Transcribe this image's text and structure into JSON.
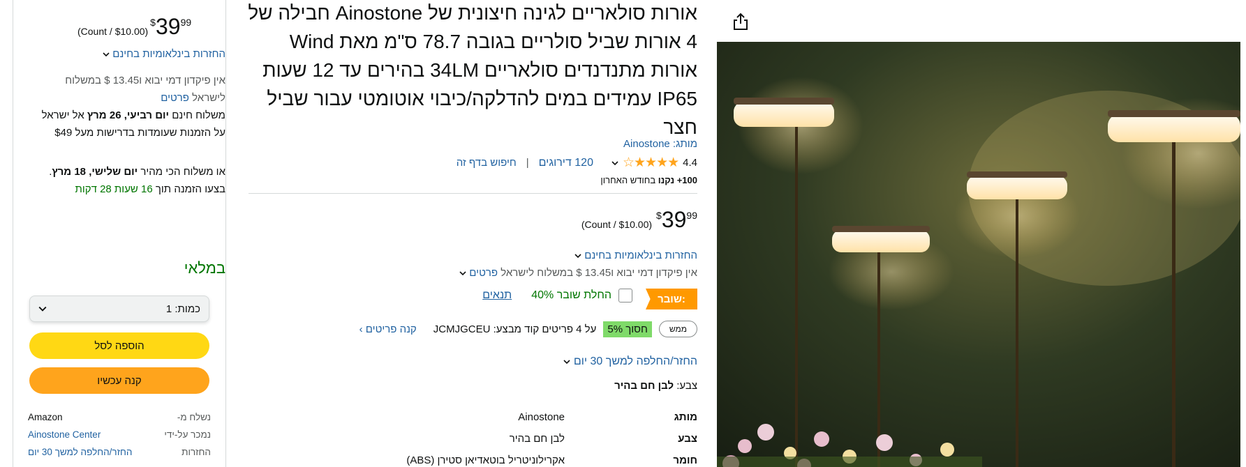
{
  "buybox": {
    "price": {
      "currency": "$",
      "whole": "39",
      "fraction": "99",
      "unit": "(Count / $10.00)"
    },
    "free_returns": "החזרות בינלאומיות בחינם",
    "import_fees_line1": "אין פיקדון דמי יבוא ו13.45 $ במשלוח",
    "import_fees_line2": "לישראל",
    "details_link": "פרטים",
    "delivery_prefix": "משלוח חינם ",
    "delivery_date": "יום רביעי, 26 מרץ",
    "delivery_suffix": " אל ישראל על הזמנות שעומדות בדרישות מעל $49",
    "fastest_prefix": "או משלוח הכי מהיר ",
    "fastest_date": "יום שלישי, 18 מרץ",
    "fastest_middle": ". בצעו הזמנה תוך ",
    "fastest_countdown": "16 שעות 28 דקות",
    "in_stock": "במלאי",
    "quantity_label": "כמות:",
    "quantity_value": "1",
    "add_to_cart": "הוספה לסל",
    "buy_now": "קנה עכשיו",
    "info": [
      {
        "key": "נשלח מ-",
        "value": "Amazon",
        "link": false
      },
      {
        "key": "נמכר על-ידי",
        "value": "Ainostone Center",
        "link": true
      },
      {
        "key": "החזרות",
        "value": "החזר/החלפה למשך 30 יום",
        "link": true
      }
    ]
  },
  "product": {
    "title": "אורות סולאריים לגינה חיצונית של Ainostone חבילה של 4 אורות שביל סולריים בגובה 78.7 ס\"מ מאת Wind אורות מתנדנדים סולאריים 34LM בהירים עד 12 שעות IP65 עמידים במים להדלקה/כיבוי אוטומטי עבור שביל חצר",
    "brand_line": "מותג: Ainostone",
    "rating": "4.4",
    "stars": "★★★★☆",
    "ratings_count": "120 דירוגים",
    "separator": "|",
    "search_page": "חיפוש בדף זה",
    "bought_bold": "100+ נקנו",
    "bought_rest": " בחודש האחרון",
    "price": {
      "currency": "$",
      "whole": "39",
      "fraction": "99",
      "unit": "(Count / $10.00)"
    },
    "free_returns": "החזרות בינלאומיות בחינם",
    "import_fees": "אין פיקדון דמי יבוא ו13.45 $ במשלוח לישראל",
    "details_link": "פרטים",
    "deal_badge": "שובר:",
    "coupon_text": "החלת שובר 40%",
    "coupon_terms": "תנאים",
    "promo_button": "ממש",
    "promo_save": "חסוך 5%",
    "promo_text": "על 4 פריטים קוד מבצע: JCMJGCEU",
    "promo_link": "קנה פריטים ›",
    "returns_policy": "החזר/החלפה למשך 30 יום",
    "color_label": "צבע: ",
    "color_value": "לבן חם בהיר",
    "specs": [
      {
        "key": "מותג",
        "value": "Ainostone"
      },
      {
        "key": "צבע",
        "value": "לבן חם בהיר"
      },
      {
        "key": "חומר",
        "value": "אקרילוניטריל בוטאדיאן סטירן (ABS)"
      }
    ]
  },
  "icons": {
    "share": "share-icon",
    "chevron": "chevron-down-icon"
  },
  "colors": {
    "link": "#2162a1",
    "add_to_cart": "#ffd814",
    "buy_now": "#ffa41c",
    "deal": "#ff9900",
    "save": "#7fda69",
    "in_stock": "#007600",
    "stars": "#ffa41c"
  }
}
